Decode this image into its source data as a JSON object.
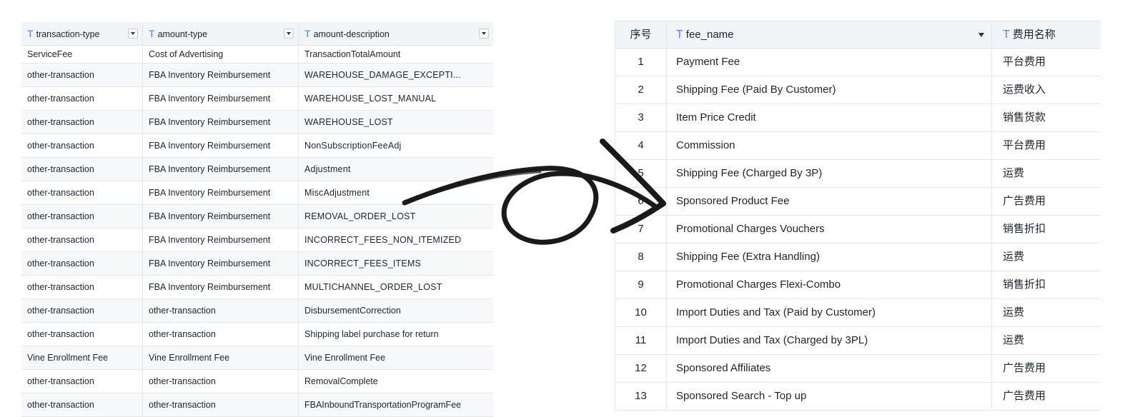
{
  "left_table": {
    "columns": [
      {
        "type_icon": "T",
        "label": "transaction-type"
      },
      {
        "type_icon": "T",
        "label": "amount-type"
      },
      {
        "type_icon": "T",
        "label": "amount-description"
      }
    ],
    "rows": [
      [
        "ServiceFee",
        "Cost of Advertising",
        "TransactionTotalAmount"
      ],
      [
        "other-transaction",
        "FBA Inventory Reimbursement",
        "WAREHOUSE_DAMAGE_EXCEPTI..."
      ],
      [
        "other-transaction",
        "FBA Inventory Reimbursement",
        "WAREHOUSE_LOST_MANUAL"
      ],
      [
        "other-transaction",
        "FBA Inventory Reimbursement",
        "WAREHOUSE_LOST"
      ],
      [
        "other-transaction",
        "FBA Inventory Reimbursement",
        "NonSubscriptionFeeAdj"
      ],
      [
        "other-transaction",
        "FBA Inventory Reimbursement",
        "Adjustment"
      ],
      [
        "other-transaction",
        "FBA Inventory Reimbursement",
        "MiscAdjustment"
      ],
      [
        "other-transaction",
        "FBA Inventory Reimbursement",
        "REMOVAL_ORDER_LOST"
      ],
      [
        "other-transaction",
        "FBA Inventory Reimbursement",
        "INCORRECT_FEES_NON_ITEMIZED"
      ],
      [
        "other-transaction",
        "FBA Inventory Reimbursement",
        "INCORRECT_FEES_ITEMS"
      ],
      [
        "other-transaction",
        "FBA Inventory Reimbursement",
        "MULTICHANNEL_ORDER_LOST"
      ],
      [
        "other-transaction",
        "other-transaction",
        "DisbursementCorrection"
      ],
      [
        "other-transaction",
        "other-transaction",
        "Shipping label purchase for return"
      ],
      [
        "Vine Enrollment Fee",
        "Vine Enrollment Fee",
        "Vine Enrollment Fee"
      ],
      [
        "other-transaction",
        "other-transaction",
        "RemovalComplete"
      ],
      [
        "other-transaction",
        "other-transaction",
        "FBAInboundTransportationProgramFee"
      ]
    ]
  },
  "right_table": {
    "columns": [
      {
        "type_icon": "",
        "label": "序号"
      },
      {
        "type_icon": "T",
        "label": "fee_name"
      },
      {
        "type_icon": "T",
        "label": "费用名称"
      }
    ],
    "rows": [
      [
        "1",
        "Payment Fee",
        "平台费用"
      ],
      [
        "2",
        "Shipping Fee (Paid By Customer)",
        "运费收入"
      ],
      [
        "3",
        "Item Price Credit",
        "销售货款"
      ],
      [
        "4",
        "Commission",
        "平台费用"
      ],
      [
        "5",
        "Shipping Fee (Charged By 3P)",
        "运费"
      ],
      [
        "6",
        "Sponsored Product Fee",
        "广告费用"
      ],
      [
        "7",
        "Promotional Charges Vouchers",
        "销售折扣"
      ],
      [
        "8",
        "Shipping Fee (Extra Handling)",
        "运费"
      ],
      [
        "9",
        "Promotional Charges Flexi-Combo",
        "销售折扣"
      ],
      [
        "10",
        "Import Duties and Tax (Paid by Customer)",
        "运费"
      ],
      [
        "11",
        "Import Duties and Tax (Charged by 3PL)",
        "运费"
      ],
      [
        "12",
        "Sponsored Affiliates",
        "广告费用"
      ],
      [
        "13",
        "Sponsored Search - Top up",
        "广告费用"
      ]
    ]
  },
  "colors": {
    "type_icon": "#4e83fd",
    "header_bg": "#f2f5f8",
    "arrow": "#1a1a1a"
  },
  "icons": {
    "column_dropdown": "chevron-down-icon",
    "connector": "hand-drawn-arrow"
  }
}
